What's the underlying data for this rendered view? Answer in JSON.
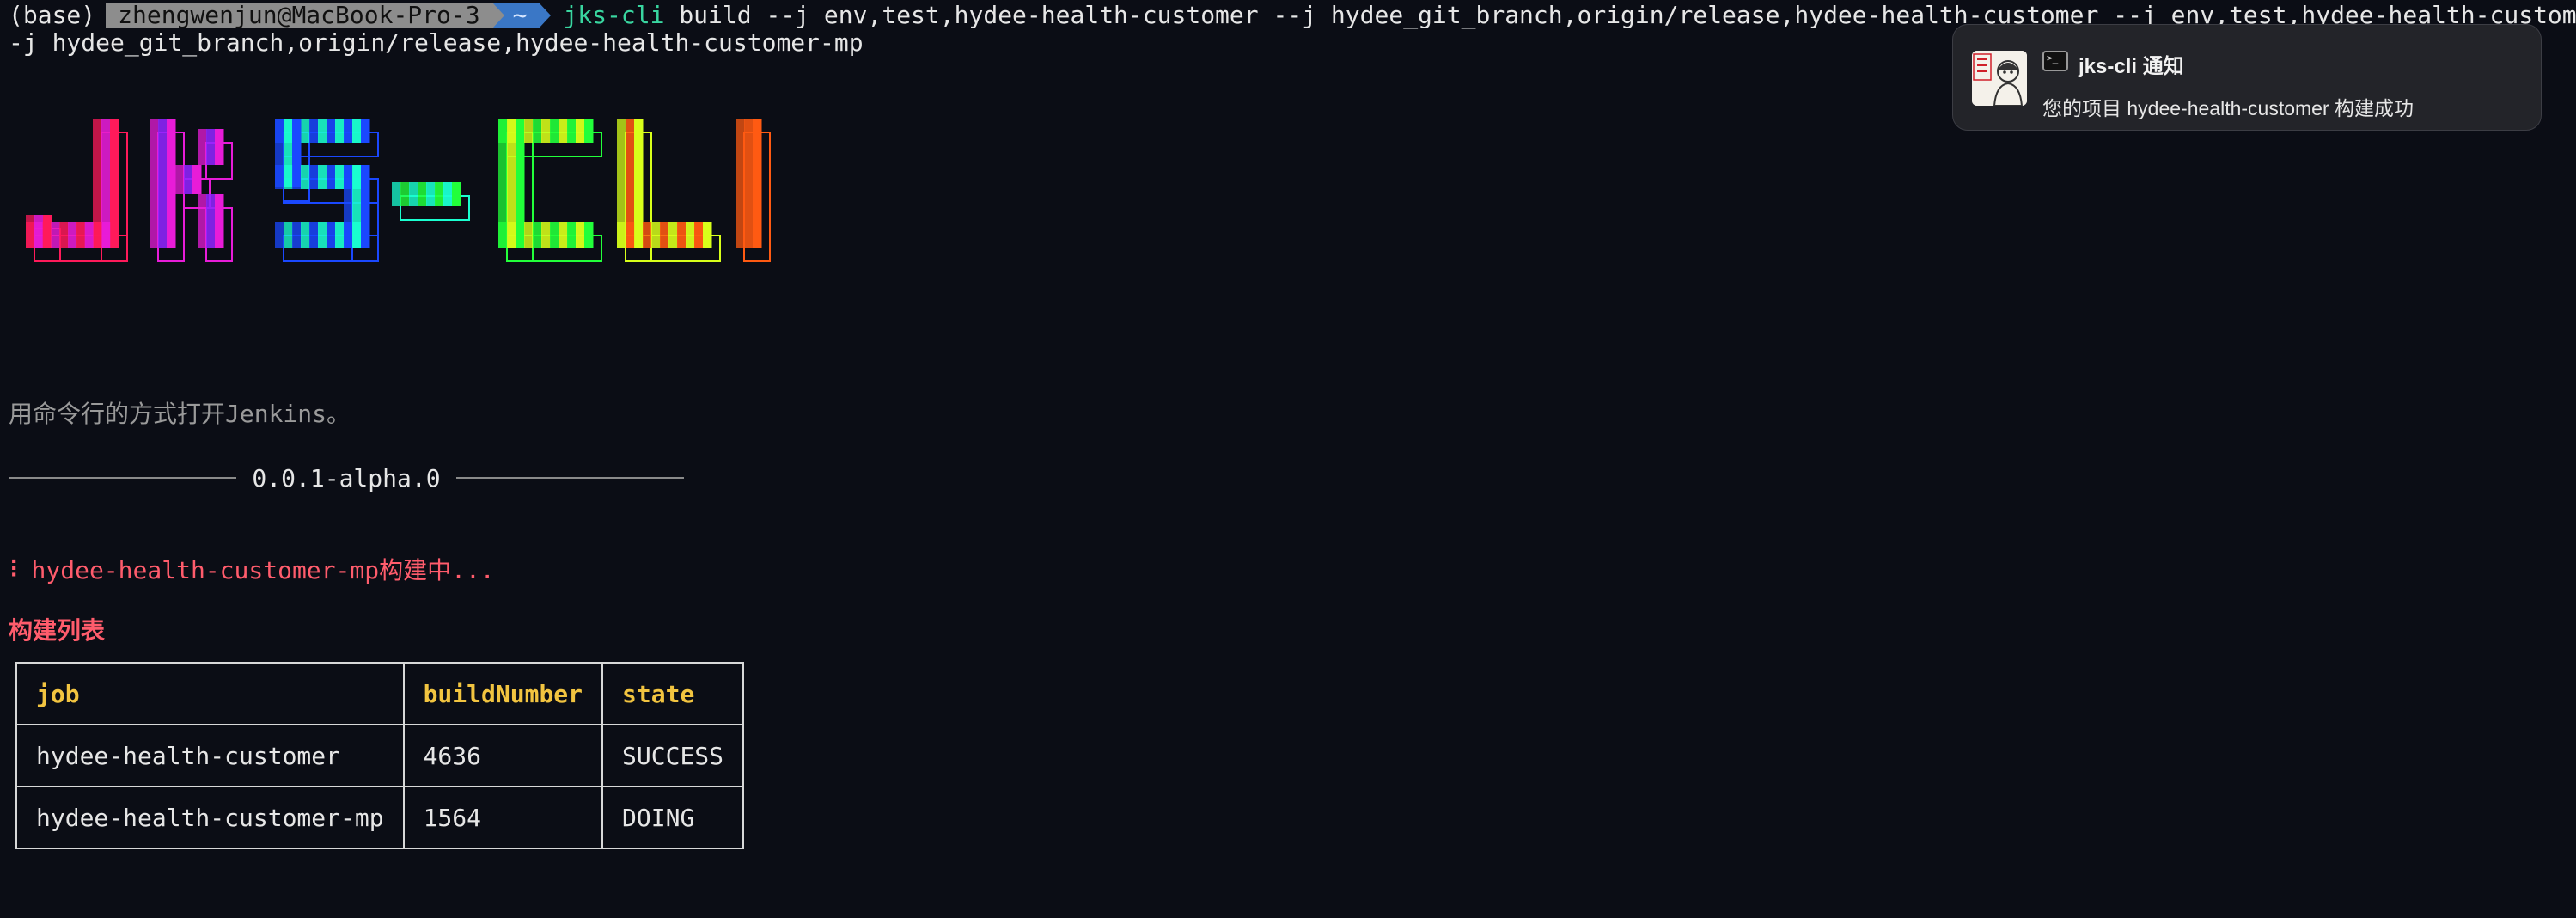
{
  "terminal": {
    "prompt_env": "(base)",
    "prompt_user_host": "zhengwenjun@MacBook-Pro-3",
    "prompt_dir": "~",
    "command_name": "jks-cli",
    "command_args_line1": " build --j env,test,hydee-health-customer --j hydee_git_branch,origin/release,hydee-health-customer --j env,test,hydee-health-customer-mp -",
    "command_args_line2": "-j hydee_git_branch,origin/release,hydee-health-customer-mp"
  },
  "banner": {
    "text": "JKS-CLI",
    "colors": [
      "#ff1a5a",
      "#e81cd8",
      "#8f24ff",
      "#1a48ff",
      "#1affd0",
      "#22ff3a",
      "#d8ff1a",
      "#ff5a12"
    ]
  },
  "tagline": "用命令行的方式打开Jenkins。",
  "version": "0.0.1-alpha.0",
  "building": {
    "spinner": "⠇",
    "text": "hydee-health-customer-mp构建中..."
  },
  "build_list": {
    "title": "构建列表",
    "headers": [
      "job",
      "buildNumber",
      "state"
    ],
    "rows": [
      [
        "hydee-health-customer",
        "4636",
        "SUCCESS"
      ],
      [
        "hydee-health-customer-mp",
        "1564",
        "DOING"
      ]
    ]
  },
  "notification": {
    "avatar_icon": "profile-avatar-icon",
    "app_icon": "terminal-icon",
    "title": "jks-cli 通知",
    "body": "您的项目 hydee-health-customer 构建成功"
  }
}
